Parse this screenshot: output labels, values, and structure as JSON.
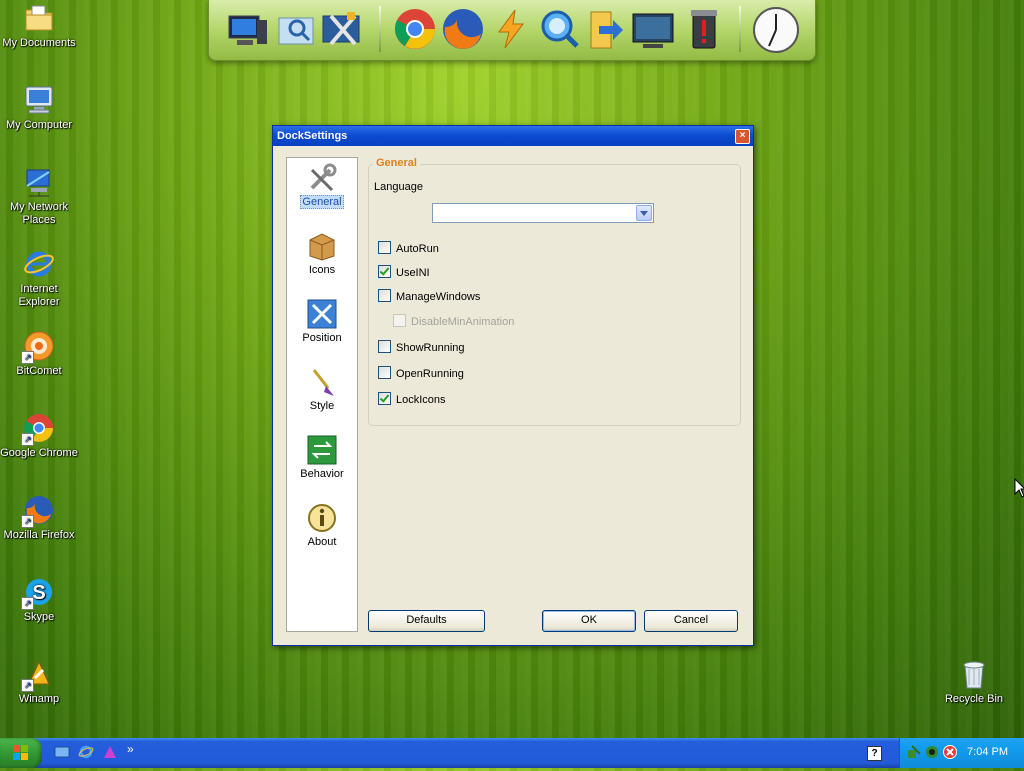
{
  "desktop": {
    "icons": [
      {
        "label": "My Documents",
        "icon": "folder-documents-icon"
      },
      {
        "label": "My Computer",
        "icon": "computer-icon"
      },
      {
        "label": "My Network Places",
        "icon": "network-icon"
      },
      {
        "label": "Internet Explorer",
        "icon": "ie-icon"
      },
      {
        "label": "BitComet",
        "icon": "bitcomet-icon"
      },
      {
        "label": "Google Chrome",
        "icon": "chrome-icon"
      },
      {
        "label": "Mozilla Firefox",
        "icon": "firefox-icon"
      },
      {
        "label": "Skype",
        "icon": "skype-icon"
      },
      {
        "label": "Winamp",
        "icon": "winamp-icon"
      },
      {
        "label": "Recycle Bin",
        "icon": "recycle-bin-icon"
      }
    ]
  },
  "dock": {
    "items": [
      "my-computer-icon",
      "display-icon",
      "tools-icon",
      "chrome-icon",
      "firefox-icon",
      "flashget-icon",
      "search-icon",
      "folder-icon",
      "monitor-icon",
      "recycle-icon",
      "clock-icon"
    ]
  },
  "dialog": {
    "title": "DockSettings",
    "close_glyph": "×",
    "nav": [
      {
        "label": "General",
        "icon": "tools-icon",
        "active": true
      },
      {
        "label": "Icons",
        "icon": "box-icon",
        "active": false
      },
      {
        "label": "Position",
        "icon": "arrows-icon",
        "active": false
      },
      {
        "label": "Style",
        "icon": "brush-icon",
        "active": false
      },
      {
        "label": "Behavior",
        "icon": "behavior-icon",
        "active": false
      },
      {
        "label": "About",
        "icon": "info-icon",
        "active": false
      }
    ],
    "group_title": "General",
    "language_label": "Language",
    "language_value": "",
    "options": [
      {
        "label": "AutoRun",
        "checked": false,
        "disabled": false
      },
      {
        "label": "UseINI",
        "checked": true,
        "disabled": false
      },
      {
        "label": "ManageWindows",
        "checked": false,
        "disabled": false
      },
      {
        "label": "DisableMinAnimation",
        "checked": false,
        "disabled": true
      },
      {
        "label": "ShowRunning",
        "checked": false,
        "disabled": false
      },
      {
        "label": "OpenRunning",
        "checked": false,
        "disabled": false
      },
      {
        "label": "LockIcons",
        "checked": true,
        "disabled": false
      }
    ],
    "buttons": {
      "defaults": "Defaults",
      "ok": "OK",
      "cancel": "Cancel"
    }
  },
  "taskbar": {
    "quicklaunch_more": "»",
    "help_glyph": "?",
    "clock": "7:04 PM"
  },
  "colors": {
    "titlebar": "#0a4bcf",
    "group_title": "#e0801a",
    "taskbar": "#245edb",
    "tray": "#139cee"
  }
}
